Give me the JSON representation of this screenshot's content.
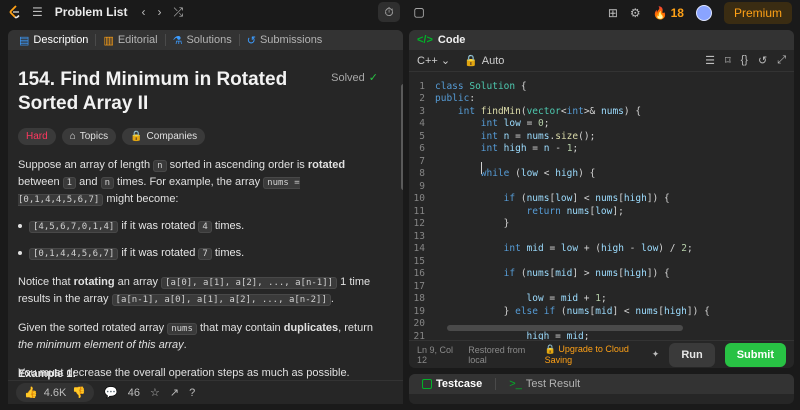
{
  "topbar": {
    "title": "Problem List",
    "streak_count": "18",
    "premium_label": "Premium"
  },
  "problem": {
    "tabs": [
      {
        "label": "Description"
      },
      {
        "label": "Editorial"
      },
      {
        "label": "Solutions"
      },
      {
        "label": "Submissions"
      }
    ],
    "title": "154. Find Minimum in Rotated Sorted Array II",
    "status": "Solved",
    "difficulty": "Hard",
    "tag_topics": "Topics",
    "tag_companies": "Companies",
    "p1_a": "Suppose an array of length",
    "p1_n": "n",
    "p1_b": "sorted in ascending order is",
    "p1_rotated": "rotated",
    "p1_c": "between",
    "p1_one": "1",
    "p1_and": "and",
    "p1_n2": "n",
    "p1_d": "times. For example, the array",
    "p1_nums": "nums = [0,1,4,4,5,6,7]",
    "p1_e": "might become:",
    "bullet1_code": "[4,5,6,7,0,1,4]",
    "bullet1_text": "if it was rotated",
    "bullet1_times": "4",
    "bullet1_end": "times.",
    "bullet2_code": "[0,1,4,4,5,6,7]",
    "bullet2_text": "if it was rotated",
    "bullet2_times": "7",
    "bullet2_end": "times.",
    "p2_a": "Notice that",
    "p2_bold": "rotating",
    "p2_b": "an array",
    "p2_code1": "[a[0], a[1], a[2], ..., a[n-1]]",
    "p2_c": "1 time results in the array",
    "p2_code2": "[a[n-1], a[0], a[1], a[2], ..., a[n-2]]",
    "p2_d": ".",
    "p3_a": "Given the sorted rotated array",
    "p3_code": "nums",
    "p3_b": "that may contain",
    "p3_bold": "duplicates",
    "p3_c": ", return",
    "p3_italic": "the minimum element of this array",
    "p3_d": ".",
    "p4": "You must decrease the overall operation steps as much as possible.",
    "example": "Example 1:",
    "likes": "4.6K",
    "comments": "46"
  },
  "code": {
    "tab_label": "Code",
    "language": "C++",
    "mode": "Auto",
    "lines": [
      {
        "n": "1",
        "text": "class Solution {"
      },
      {
        "n": "2",
        "text": "public:"
      },
      {
        "n": "3",
        "text": "    int findMin(vector<int>& nums) {"
      },
      {
        "n": "4",
        "text": "        int low = 0;"
      },
      {
        "n": "5",
        "text": "        int n = nums.size();"
      },
      {
        "n": "6",
        "text": "        int high = n - 1;"
      },
      {
        "n": "7",
        "text": ""
      },
      {
        "n": "8",
        "text": "        while (low < high) {"
      },
      {
        "n": "9",
        "text": ""
      },
      {
        "n": "10",
        "text": "            if (nums[low] < nums[high]) {"
      },
      {
        "n": "11",
        "text": "                return nums[low];"
      },
      {
        "n": "12",
        "text": "            }"
      },
      {
        "n": "13",
        "text": ""
      },
      {
        "n": "14",
        "text": "            int mid = low + (high - low) / 2;"
      },
      {
        "n": "15",
        "text": ""
      },
      {
        "n": "16",
        "text": "            if (nums[mid] > nums[high]) {"
      },
      {
        "n": "17",
        "text": ""
      },
      {
        "n": "18",
        "text": "                low = mid + 1;"
      },
      {
        "n": "19",
        "text": "            } else if (nums[mid] < nums[high]) {"
      },
      {
        "n": "20",
        "text": ""
      },
      {
        "n": "21",
        "text": "                high = mid;"
      }
    ],
    "cursor_pos": "Ln 9, Col 12",
    "restored": "Restored from local",
    "upgrade": "Upgrade to Cloud Saving",
    "run_label": "Run",
    "submit_label": "Submit"
  },
  "test": {
    "testcase_label": "Testcase",
    "result_label": "Test Result"
  },
  "colors": {
    "accent": "#ffa116",
    "green": "#28c244",
    "hard": "#ff375f"
  }
}
